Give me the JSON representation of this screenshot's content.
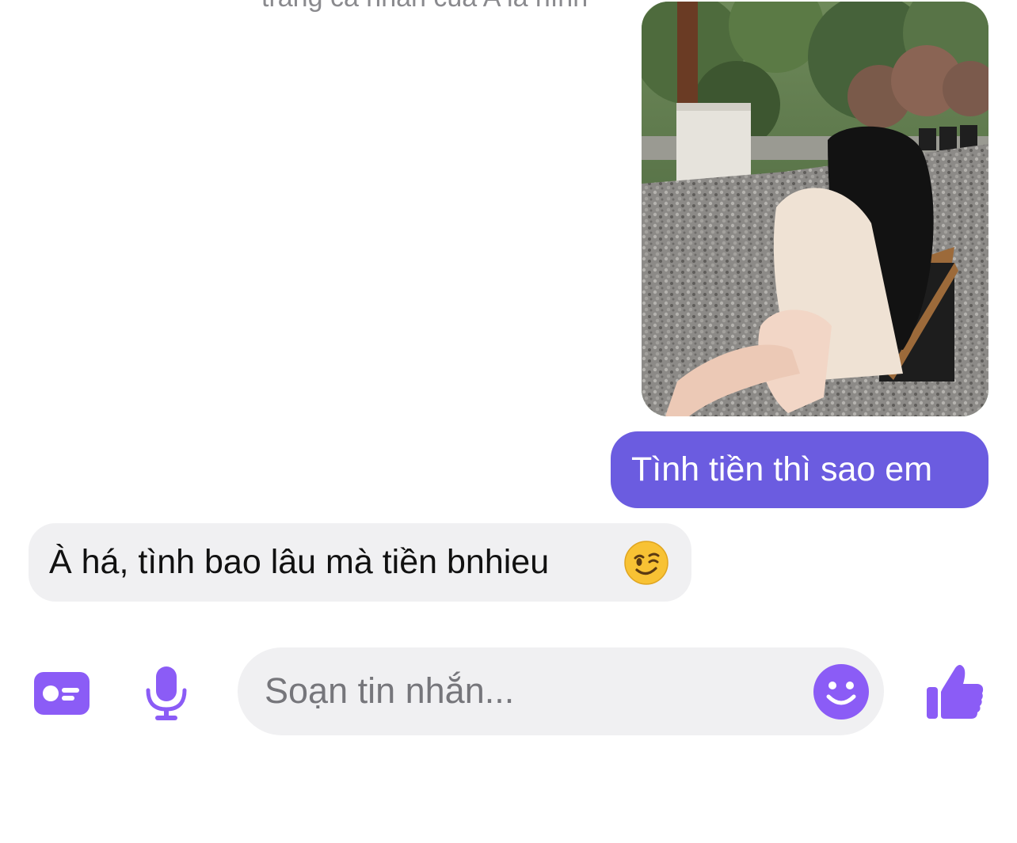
{
  "thread": {
    "cut_text": "trang cá nhân của A là hình",
    "photo": {
      "description": "woman with long black hair sitting on chair in gravel garden"
    },
    "messages": [
      {
        "direction": "outgoing",
        "text": "Tình tiền thì sao em"
      },
      {
        "direction": "incoming",
        "text": "À há, tình bao lâu mà tiền bnhieu",
        "emoji": "winking-face"
      }
    ]
  },
  "composer": {
    "placeholder": "Soạn tin nhắn...",
    "value": ""
  },
  "icons": {
    "left": [
      "id-card-icon",
      "microphone-icon"
    ],
    "inside_input": "smiley-icon",
    "right": "thumbs-up-icon"
  },
  "colors": {
    "accent": "#8b5cf6",
    "outgoing_bubble": "#6b5ce0",
    "incoming_bubble": "#f0f0f2",
    "composer_bg": "#f0f0f2"
  }
}
